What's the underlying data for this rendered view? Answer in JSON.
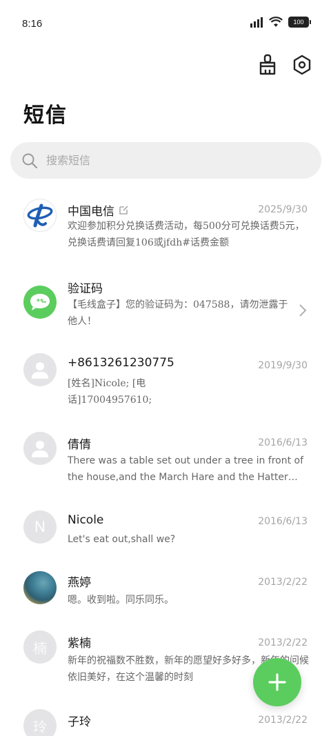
{
  "status": {
    "time": "8:16",
    "battery": "100"
  },
  "header": {
    "title": "短信"
  },
  "search": {
    "placeholder": "搜索短信"
  },
  "messages": [
    {
      "name": "中国电信",
      "date": "2025/9/30",
      "preview": "欢迎参加积分兑换话费活动，每500分可兑换话费5元，兑换话费请回复106或jfdh#话费金额"
    },
    {
      "name": "验证码",
      "date": "",
      "preview": "【毛线盒子】您的验证码为：047588，请勿泄露于他人！"
    },
    {
      "name": "+8613261230775",
      "date": "2019/9/30",
      "preview": "[姓名]Nicole; [电话]17004957610;"
    },
    {
      "name": "倩倩",
      "date": "2016/6/13",
      "preview": "There was a table set out under a tree in front of the house,and the March Hare and the Hatter were having tea at it"
    },
    {
      "name": "Nicole",
      "avatar": "N",
      "date": "2016/6/13",
      "preview": "Let's eat out,shall we?"
    },
    {
      "name": "燕婷",
      "date": "2013/2/22",
      "preview": "嗯。收到啦。同乐同乐。"
    },
    {
      "name": "紫楠",
      "avatar": "楠",
      "date": "2013/2/22",
      "preview": "新年的祝福数不胜数，新年的愿望好多好多，新年的问候依旧美好，在这个温馨的时刻"
    },
    {
      "name": "子玲",
      "avatar": "玲",
      "date": "2013/2/22",
      "preview": ""
    }
  ],
  "colors": {
    "accent": "#5bcd5e",
    "telecom": "#1f5fb4"
  }
}
